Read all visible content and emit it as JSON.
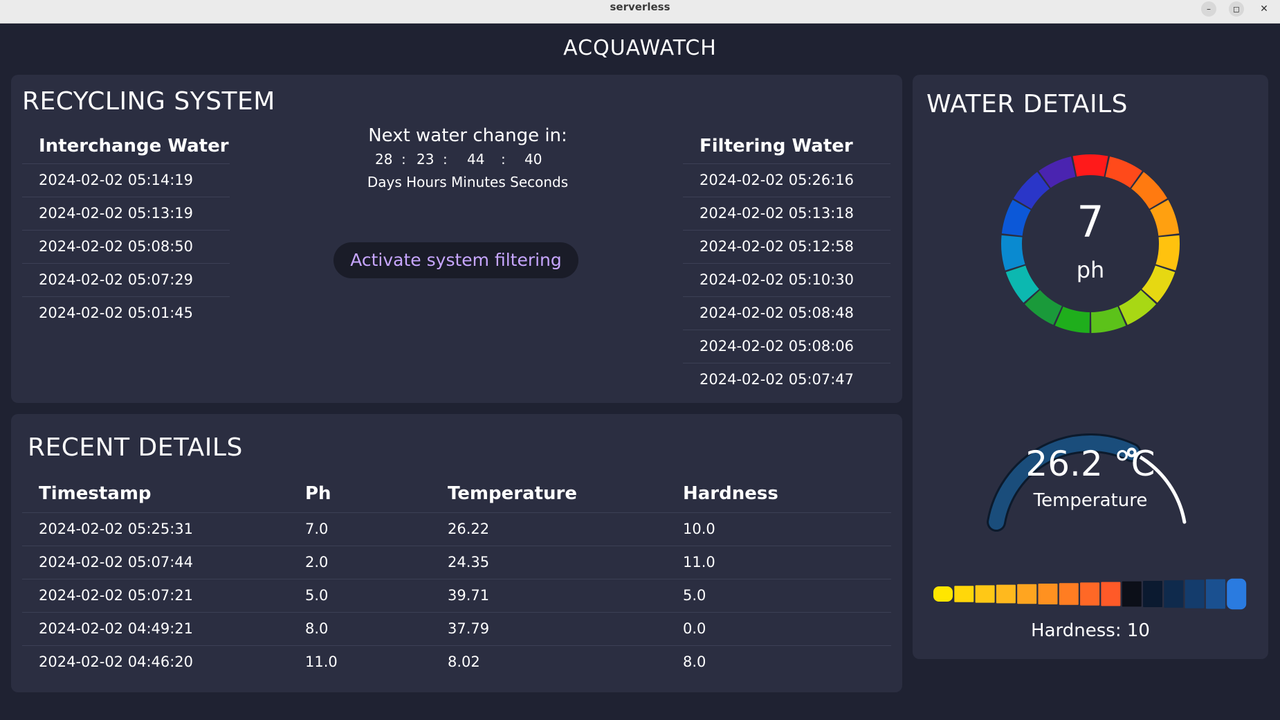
{
  "window": {
    "title": "serverless",
    "min_glyph": "–",
    "max_glyph": "◻",
    "close_glyph": "✕"
  },
  "app": {
    "title": "ACQUAWATCH"
  },
  "recycling": {
    "title": "RECYCLING SYSTEM",
    "interchange": {
      "header": "Interchange Water",
      "items": [
        "2024-02-02 05:14:19",
        "2024-02-02 05:13:19",
        "2024-02-02 05:08:50",
        "2024-02-02 05:07:29",
        "2024-02-02 05:01:45"
      ]
    },
    "filtering": {
      "header": "Filtering Water",
      "items": [
        "2024-02-02 05:26:16",
        "2024-02-02 05:13:18",
        "2024-02-02 05:12:58",
        "2024-02-02 05:10:30",
        "2024-02-02 05:08:48",
        "2024-02-02 05:08:06",
        "2024-02-02 05:07:47"
      ]
    },
    "countdown": {
      "title": "Next water change in:",
      "days": "28",
      "hours": "23",
      "minutes": "44",
      "seconds": "40",
      "sep": ":",
      "units": "Days Hours Minutes Seconds"
    },
    "activate_button": "Activate system filtering"
  },
  "recent": {
    "title": "RECENT DETAILS",
    "columns": [
      "Timestamp",
      "Ph",
      "Temperature",
      "Hardness"
    ],
    "rows": [
      [
        "2024-02-02 05:25:31",
        "7.0",
        "26.22",
        "10.0"
      ],
      [
        "2024-02-02 05:07:44",
        "2.0",
        "24.35",
        "11.0"
      ],
      [
        "2024-02-02 05:07:21",
        "5.0",
        "39.71",
        "5.0"
      ],
      [
        "2024-02-02 04:49:21",
        "8.0",
        "37.79",
        "0.0"
      ],
      [
        "2024-02-02 04:46:20",
        "11.0",
        "8.02",
        "8.0"
      ]
    ]
  },
  "water": {
    "title": "WATER DETAILS",
    "ph": {
      "value": "7",
      "unit": "ph"
    },
    "temperature": {
      "value_text": "26.2 °C",
      "label": "Temperature",
      "fill_fraction": 0.66
    },
    "hardness": {
      "label": "Hardness: 10",
      "segments": 15,
      "colors": [
        "#ffe600",
        "#ffd70a",
        "#ffc816",
        "#ffb91e",
        "#ffa520",
        "#ff9120",
        "#ff7d22",
        "#ff6826",
        "#ff5a28",
        "#0c0f18",
        "#0b1a30",
        "#0f2a4c",
        "#143c6c",
        "#1a5090",
        "#2a7be0"
      ]
    },
    "colors": {
      "accent": "#c7a6ff",
      "temp_arc": "#1c5384",
      "temp_bg": "#0c1a2c"
    }
  }
}
